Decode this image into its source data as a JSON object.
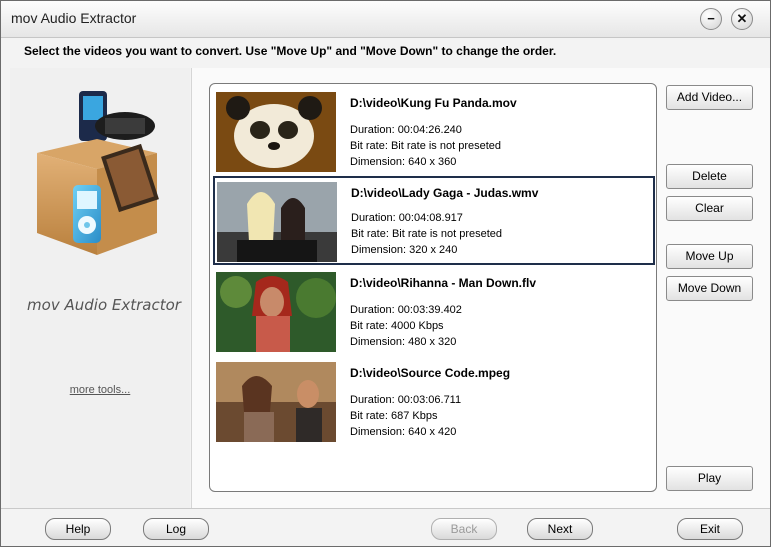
{
  "window": {
    "title": "mov Audio Extractor"
  },
  "instruction": "Select the videos you want to convert. Use \"Move Up\" and \"Move Down\" to change the order.",
  "sidebar": {
    "brand": "mov Audio Extractor",
    "more_tools": "more tools..."
  },
  "videos": [
    {
      "path": "D:\\video\\Kung Fu Panda.mov",
      "duration": "Duration: 00:04:26.240",
      "bitrate": "Bit rate: Bit rate is not preseted",
      "dimension": "Dimension: 640 x 360",
      "selected": false
    },
    {
      "path": "D:\\video\\Lady Gaga - Judas.wmv",
      "duration": "Duration: 00:04:08.917",
      "bitrate": "Bit rate: Bit rate is not preseted",
      "dimension": "Dimension: 320 x 240",
      "selected": true
    },
    {
      "path": "D:\\video\\Rihanna - Man Down.flv",
      "duration": "Duration: 00:03:39.402",
      "bitrate": "Bit rate: 4000 Kbps",
      "dimension": "Dimension: 480 x 320",
      "selected": false
    },
    {
      "path": "D:\\video\\Source Code.mpeg",
      "duration": "Duration: 00:03:06.711",
      "bitrate": "Bit rate: 687 Kbps",
      "dimension": "Dimension: 640 x 420",
      "selected": false
    }
  ],
  "actions": {
    "add_video": "Add Video...",
    "delete": "Delete",
    "clear": "Clear",
    "move_up": "Move Up",
    "move_down": "Move Down",
    "play": "Play"
  },
  "footer": {
    "help": "Help",
    "log": "Log",
    "back": "Back",
    "next": "Next",
    "exit": "Exit"
  }
}
